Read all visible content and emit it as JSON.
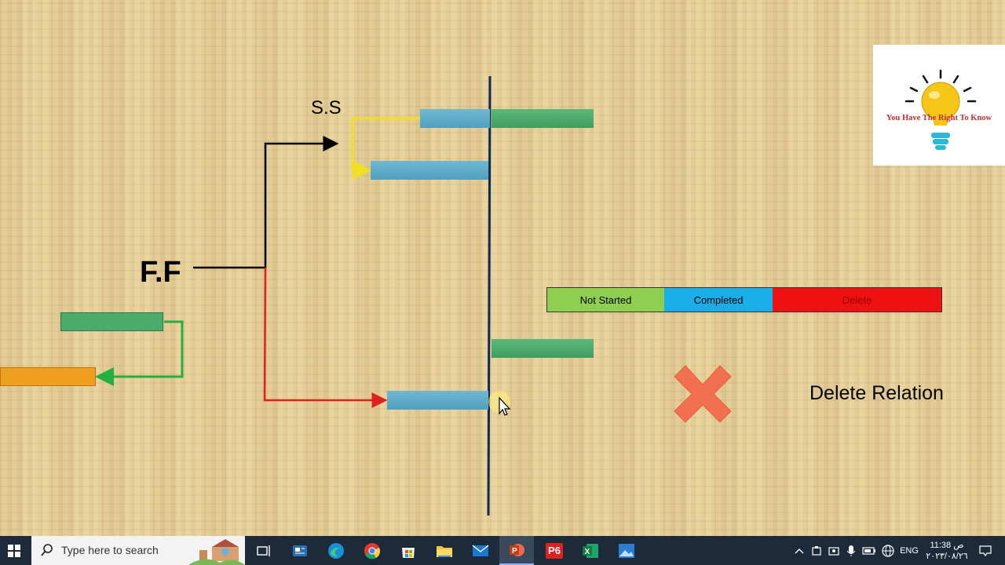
{
  "slide": {
    "ss_label": "S.S",
    "ff_label": "F.F",
    "delete_relation": "Delete Relation",
    "legend": [
      {
        "label": "Not Started",
        "color": "#8fcf50"
      },
      {
        "label": "Completed",
        "color": "#1aaee8"
      },
      {
        "label": "Delete",
        "color": "#ee1111"
      }
    ],
    "logo_text": "You Have The Right To Know",
    "colors": {
      "blue_bar": "#5aaac8",
      "green_bar": "#4aab6b",
      "orange_bar": "#f0a020",
      "timeline": "#0f2a55",
      "ss_arrow": "#f0e020",
      "ff_red_arrow": "#e02020",
      "green_arrow": "#22b040",
      "delete_x": "#f07050"
    }
  },
  "taskbar": {
    "search_placeholder": "Type here to search",
    "apps": [
      "task-view-icon",
      "news-icon",
      "edge-icon",
      "chrome-icon",
      "store-icon",
      "file-explorer-icon",
      "mail-icon",
      "powerpoint-icon",
      "p6-icon",
      "excel-icon",
      "photos-icon"
    ],
    "p6_label": "P6",
    "language": "ENG",
    "time": "11:38 ص",
    "date": "٢٠٢٣/٠٨/٢٦"
  }
}
